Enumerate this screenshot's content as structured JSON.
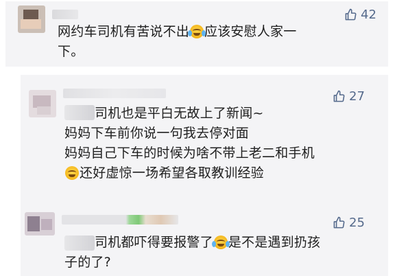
{
  "comments": [
    {
      "likes": "42",
      "lines": [
        "网约车司机有苦说不出",
        "应该安慰人家一",
        "下。"
      ]
    },
    {
      "likes": "27",
      "lines": [
        "司机也是平白无故上了新闻~",
        "妈妈下车前你说一句我去停对面",
        "妈妈自己下车的时候为啥不带上老二和手机",
        "还好虚惊一场希望各取教训经验"
      ]
    },
    {
      "likes": "25",
      "lines": [
        "司机都吓得要报警了",
        "是不是遇到扔孩",
        "子的了?"
      ]
    }
  ],
  "icons": {
    "like": "thumbs-up-icon",
    "emoji_cry": "crying-laughing-emoji-icon",
    "emoji_smile": "squinting-smile-emoji-icon"
  },
  "colors": {
    "card_bg": "#f4f4f6",
    "like_color": "#556a8c",
    "text_color": "#202020"
  }
}
